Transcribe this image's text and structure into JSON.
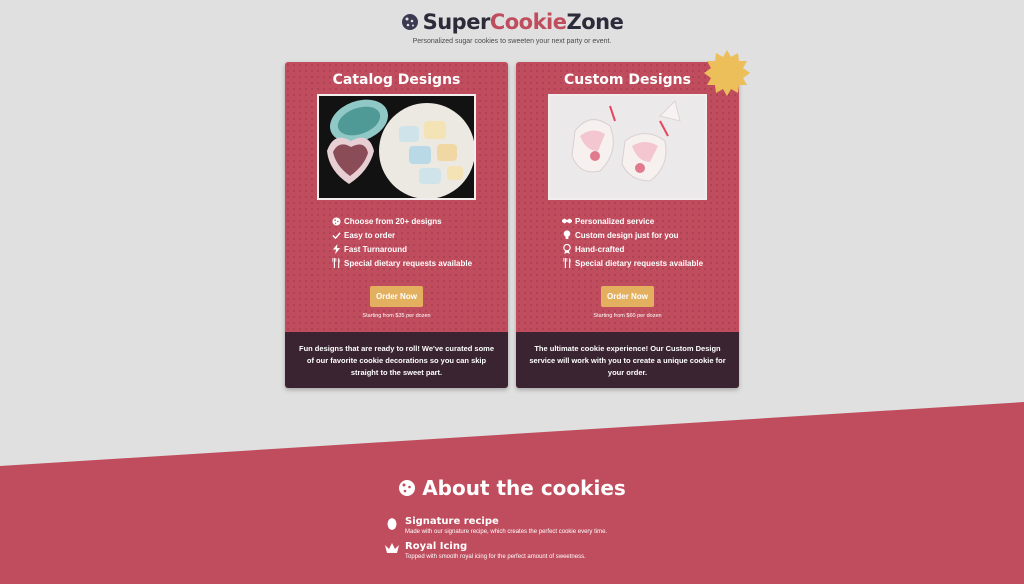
{
  "header": {
    "logo_part1": "Super",
    "logo_part2": "Cookie",
    "logo_part3": "Zone",
    "tagline": "Personalized sugar cookies to sweeten your next party or event."
  },
  "cards": [
    {
      "title": "Catalog Designs",
      "features": [
        {
          "icon": "cookie-icon",
          "text": "Choose from 20+ designs"
        },
        {
          "icon": "check-icon",
          "text": "Easy to order"
        },
        {
          "icon": "lightning-icon",
          "text": "Fast Turnaround"
        },
        {
          "icon": "utensils-icon",
          "text": "Special dietary requests available"
        }
      ],
      "button": "Order Now",
      "price": "Starting from $35 per dozen",
      "footer": "Fun designs that are ready to roll! We've curated some of our favorite cookie decorations so you can skip straight to the sweet part."
    },
    {
      "title": "Custom Designs",
      "features": [
        {
          "icon": "handshake-icon",
          "text": "Personalized service"
        },
        {
          "icon": "lightbulb-icon",
          "text": "Custom design just for you"
        },
        {
          "icon": "award-icon",
          "text": "Hand-crafted"
        },
        {
          "icon": "utensils-icon",
          "text": "Special dietary requests available"
        }
      ],
      "button": "Order Now",
      "price": "Starting from $60 per dozen",
      "footer": "The ultimate cookie experience! Our Custom Design service will work with you to create a unique cookie for your order."
    }
  ],
  "about": {
    "title": "About the cookies",
    "items": [
      {
        "icon": "egg-icon",
        "title": "Signature recipe",
        "text": "Made with our signature recipe, which creates the perfect cookie every time."
      },
      {
        "icon": "crown-icon",
        "title": "Royal Icing",
        "text": "Topped with smooth royal icing for the perfect amount of sweetness."
      }
    ]
  },
  "colors": {
    "background": "#dfe0df",
    "brand_pink": "#c04d5e",
    "dark_plum": "#3a2431",
    "button_gold": "#e3b05f",
    "badge_yellow": "#edbf5a"
  }
}
